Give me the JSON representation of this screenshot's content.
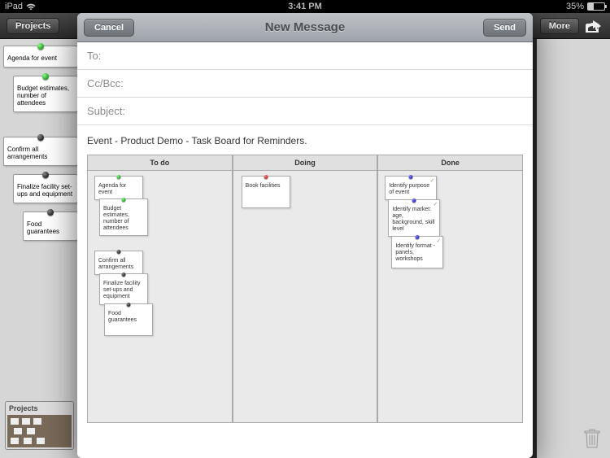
{
  "status": {
    "device": "iPad",
    "time": "3:41 PM",
    "battery_pct": "35%"
  },
  "bg": {
    "projects_btn": "Projects",
    "more_btn": "More",
    "projects_label": "Projects",
    "cards": {
      "agenda": "Agenda for event",
      "budget": "Budget estimates, number of attendees",
      "confirm": "Confirm all arrangements",
      "finalize": "Finalize facility set-ups and equipment",
      "food": "Food guarantees"
    }
  },
  "modal": {
    "cancel": "Cancel",
    "title": "New Message",
    "send": "Send",
    "to_label": "To:",
    "cc_label": "Cc/Bcc:",
    "subject_label": "Subject:",
    "body_title": "Event - Product Demo - Task Board for Reminders.",
    "columns": {
      "todo": "To do",
      "doing": "Doing",
      "done": "Done"
    },
    "todo_cards": {
      "agenda": "Agenda for event",
      "budget": "Budget estimates, number of attendees",
      "confirm": "Confirm all arrangements",
      "finalize": "Finalize facility set-ups and equipment",
      "food": "Food guarantees"
    },
    "doing_cards": {
      "book": "Book facilities"
    },
    "done_cards": {
      "purpose": "Identify purpose of event",
      "market": "Identify market: age, background, skill level",
      "format": "Identify format - panels, workshops"
    }
  }
}
